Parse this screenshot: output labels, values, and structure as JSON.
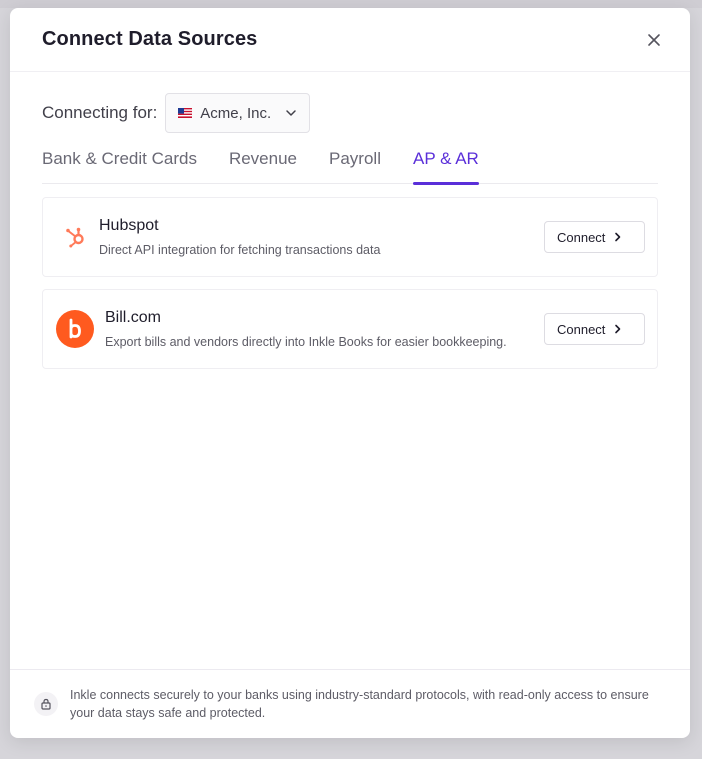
{
  "modal": {
    "title": "Connect Data Sources",
    "close_icon": "close-icon"
  },
  "connecting": {
    "label": "Connecting for:",
    "entity": "Acme, Inc.",
    "flag_icon": "us-flag-icon"
  },
  "tabs": [
    {
      "label": "Bank & Credit Cards",
      "active": false
    },
    {
      "label": "Revenue",
      "active": false
    },
    {
      "label": "Payroll",
      "active": false
    },
    {
      "label": "AP & AR",
      "active": true
    }
  ],
  "integrations": [
    {
      "name": "Hubspot",
      "description": "Direct API integration for fetching transactions data",
      "button": "Connect",
      "icon": "hubspot-logo-icon"
    },
    {
      "name": "Bill.com",
      "description": "Export bills and vendors directly into Inkle Books for easier bookkeeping.",
      "button": "Connect",
      "icon": "billcom-logo-icon"
    }
  ],
  "footer": {
    "text": "Inkle connects securely to your banks using industry-standard protocols, with read-only access to ensure your data stays safe and protected.",
    "icon": "lock-icon"
  },
  "colors": {
    "accent": "#5a2fd9",
    "hubspot": "#ff7a59",
    "billcom": "#ff5a1f"
  }
}
